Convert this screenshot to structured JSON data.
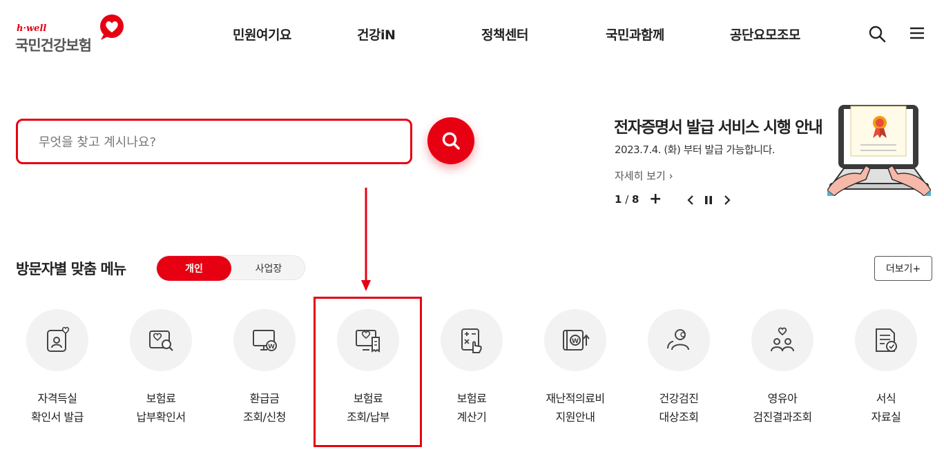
{
  "logo": {
    "tagline": "h·well",
    "name": "국민건강보험"
  },
  "gnb": [
    "민원여기요",
    "건강iN",
    "정책센터",
    "국민과함께",
    "공단요모조모"
  ],
  "header_icons": [
    "search-icon",
    "hamburger-menu-icon"
  ],
  "search": {
    "placeholder": "무엇을 찾고 계시나요?"
  },
  "banner": {
    "title": "전자증명서 발급 서비스 시행 안내",
    "subtitle": "2023.7.4. (화) 부터 발급 가능합니다.",
    "more": "자세히 보기",
    "pager_current": "1",
    "pager_sep": " / ",
    "pager_total": "8",
    "plus": "+"
  },
  "section": {
    "title": "방문자별 맞춤 메뉴",
    "tab_personal": "개인",
    "tab_business": "사업장",
    "more": "더보기+"
  },
  "menu": [
    {
      "line1": "자격득실",
      "line2": "확인서 발급",
      "icon": "id-card-heart-icon"
    },
    {
      "line1": "보험료",
      "line2": "납부확인서",
      "icon": "document-search-icon"
    },
    {
      "line1": "환급금",
      "line2": "조회/신청",
      "icon": "monitor-won-icon"
    },
    {
      "line1": "보험료",
      "line2": "조회/납부",
      "icon": "payment-receipt-icon"
    },
    {
      "line1": "보험료",
      "line2": "계산기",
      "icon": "calculator-hand-icon"
    },
    {
      "line1": "재난적의료비",
      "line2": "지원안내",
      "icon": "book-won-up-icon"
    },
    {
      "line1": "건강검진",
      "line2": "대상조회",
      "icon": "people-search-icon"
    },
    {
      "line1": "영유아",
      "line2": "검진결과조회",
      "icon": "family-heart-icon"
    },
    {
      "line1": "서식",
      "line2": "자료실",
      "icon": "form-document-icon"
    }
  ],
  "colors": {
    "accent": "#e60012"
  }
}
